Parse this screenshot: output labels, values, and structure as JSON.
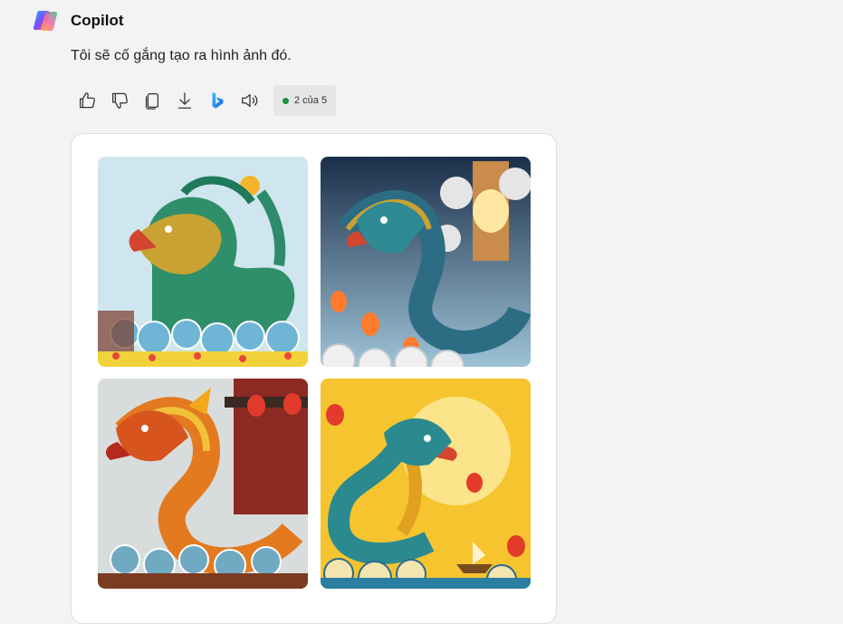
{
  "header": {
    "sender": "Copilot",
    "logo_icon": "copilot-logo-icon"
  },
  "message": {
    "text": "Tôi sẽ cố gắng tạo ra hình ảnh đó."
  },
  "actions": {
    "icons": [
      "thumbs-up-icon",
      "thumbs-down-icon",
      "copy-icon",
      "download-icon",
      "bing-icon",
      "speaker-icon"
    ],
    "counter_label": "2 của 5",
    "counter_dot_color": "#1e8e3e"
  },
  "images": [
    {
      "subject": "dragon-statue-green-gold",
      "sky": "#cfe6ee"
    },
    {
      "subject": "dragon-blue-lanterns",
      "sky": "#20354f"
    },
    {
      "subject": "dragon-orange-temple",
      "sky": "#d9dcdc"
    },
    {
      "subject": "dragon-teal-yellow-sun",
      "sky": "#f6c42e"
    }
  ]
}
